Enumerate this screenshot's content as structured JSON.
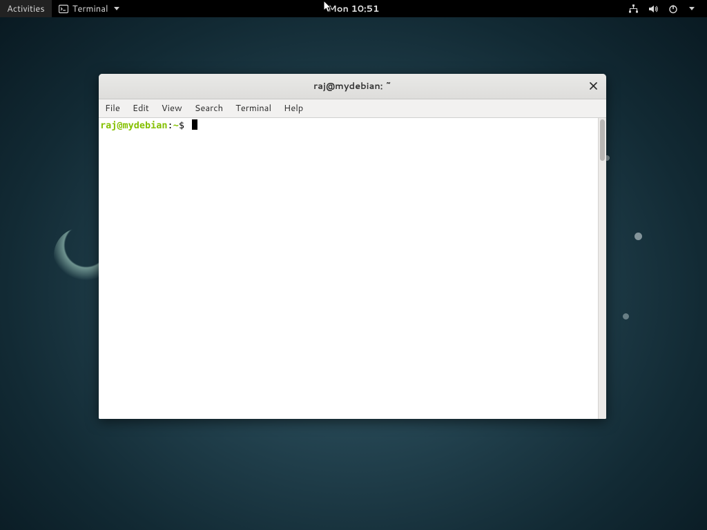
{
  "topbar": {
    "activities": "Activities",
    "app_name": "Terminal",
    "clock": "Mon 10:51"
  },
  "window": {
    "title": "raj@mydebian: ~"
  },
  "menubar": {
    "items": [
      "File",
      "Edit",
      "View",
      "Search",
      "Terminal",
      "Help"
    ]
  },
  "terminal": {
    "prompt_userhost": "raj@mydebian",
    "prompt_path": "~",
    "prompt_separator": ":",
    "prompt_symbol": "$"
  },
  "colors": {
    "prompt_user": "#84c000"
  }
}
